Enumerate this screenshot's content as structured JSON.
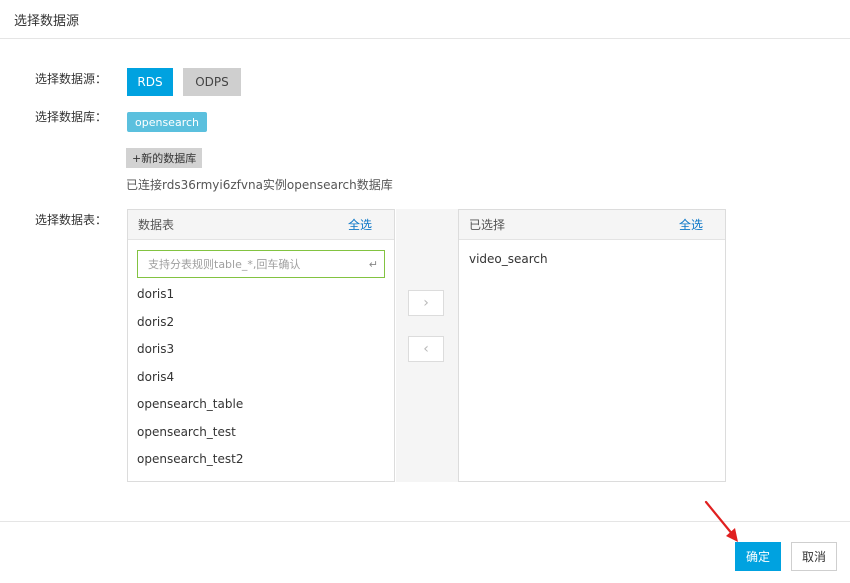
{
  "dialog": {
    "title": "选择数据源"
  },
  "labels": {
    "source": "选择数据源：",
    "database": "选择数据库：",
    "table": "选择数据表："
  },
  "source_options": {
    "rds": "RDS",
    "odps": "ODPS",
    "selected": "RDS"
  },
  "database": {
    "selected": "opensearch",
    "new_button": "+新的数据库",
    "status": "已连接rds36rmyi6zfvna实例opensearch数据库"
  },
  "left_panel": {
    "title": "数据表",
    "select_all": "全选",
    "search_placeholder": "支持分表规则table_*,回车确认",
    "search_value": "",
    "enter_hint": "↵",
    "items": [
      "doris1",
      "doris2",
      "doris3",
      "doris4",
      "opensearch_table",
      "opensearch_test",
      "opensearch_test2"
    ]
  },
  "transfer": {
    "right_arrow": "›",
    "left_arrow": "‹"
  },
  "right_panel": {
    "title": "已选择",
    "select_all": "全选",
    "items": [
      "video_search"
    ]
  },
  "footer": {
    "confirm": "确定",
    "cancel": "取消"
  },
  "colors": {
    "primary": "#00a2e0",
    "tag": "#5bc0de",
    "link": "#0a76c7",
    "input_focus": "#82c341",
    "annotation_arrow": "#e02020"
  },
  "icons": {
    "enter": "enter-icon",
    "move_right": "chevron-right-icon",
    "move_left": "chevron-left-icon",
    "annotation": "red-arrow-annotation"
  }
}
